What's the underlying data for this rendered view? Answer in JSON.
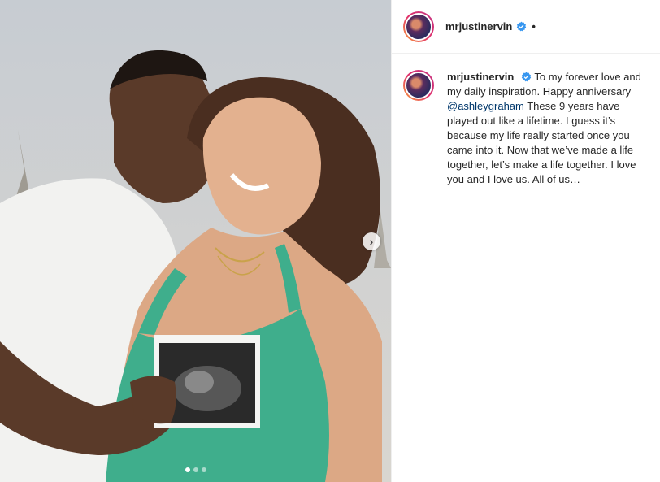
{
  "post": {
    "username": "mrjustinervin",
    "separator": "•",
    "caption": {
      "username": "mrjustinervin",
      "text_before": "To my forever love and my daily inspiration. Happy anniversary ",
      "mention": "@ashleygraham",
      "text_after": " These 9 years have played out like a lifetime. I guess it’s because my life really started once you came into it. Now that we’ve made a life together, let’s make a life together. I love you and I love us. All of us…"
    },
    "carousel": {
      "current": 1,
      "total": 3
    }
  },
  "icons": {
    "verified": "verified-badge-icon",
    "next": "chevron-right-icon"
  },
  "colors": {
    "verified": "#3897f0",
    "mention": "#00376b",
    "text": "#262626",
    "tank_top": "#3fae8c",
    "sky": "#c9ced3"
  }
}
